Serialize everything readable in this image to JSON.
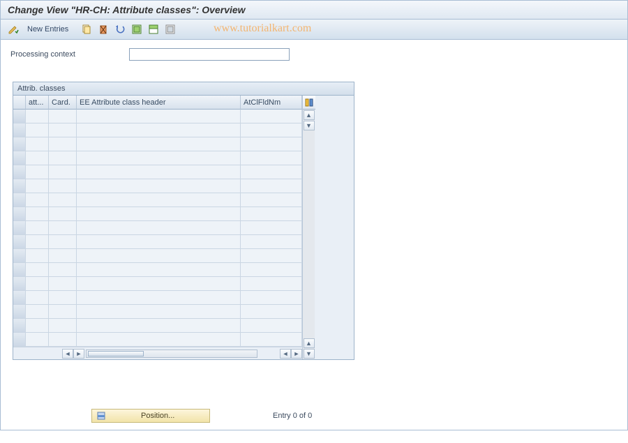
{
  "header": {
    "title": "Change View \"HR-CH: Attribute classes\": Overview"
  },
  "toolbar": {
    "new_entries_label": "New Entries",
    "watermark": "www.tutorialkart.com"
  },
  "processing": {
    "label": "Processing context",
    "value": ""
  },
  "table": {
    "title": "Attrib. classes",
    "columns": {
      "att": "att...",
      "card": "Card.",
      "header": "EE Attribute class header",
      "fld": "AtClFldNm"
    },
    "row_count": 17
  },
  "footer": {
    "position_label": "Position...",
    "entry_text": "Entry 0 of 0"
  }
}
